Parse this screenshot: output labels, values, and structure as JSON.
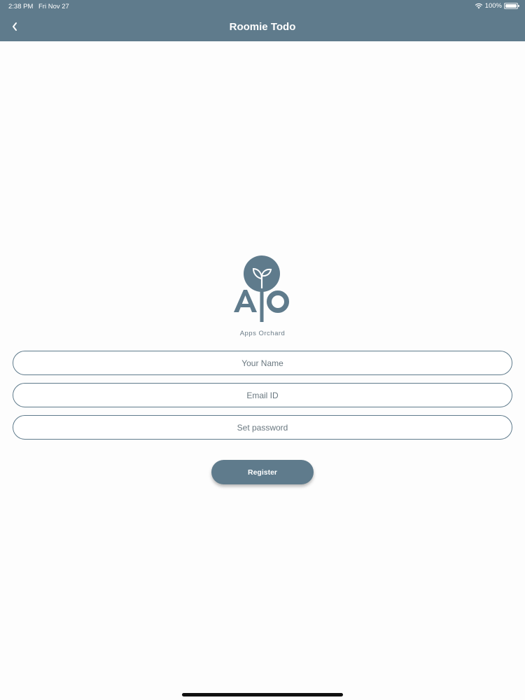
{
  "status_bar": {
    "time": "2:38 PM",
    "date": "Fri Nov 27",
    "battery": "100%",
    "icons": [
      "wifi-icon",
      "battery-icon"
    ]
  },
  "nav": {
    "title": "Roomie Todo",
    "back_icon": "chevron-left-icon"
  },
  "logo": {
    "caption": "Apps Orchard"
  },
  "form": {
    "name_placeholder": "Your Name",
    "email_placeholder": "Email ID",
    "password_placeholder": "Set password",
    "register_label": "Register"
  },
  "colors": {
    "primary": "#5f7b8c",
    "background": "#fdfdfd",
    "text_muted": "#6b7c88"
  }
}
